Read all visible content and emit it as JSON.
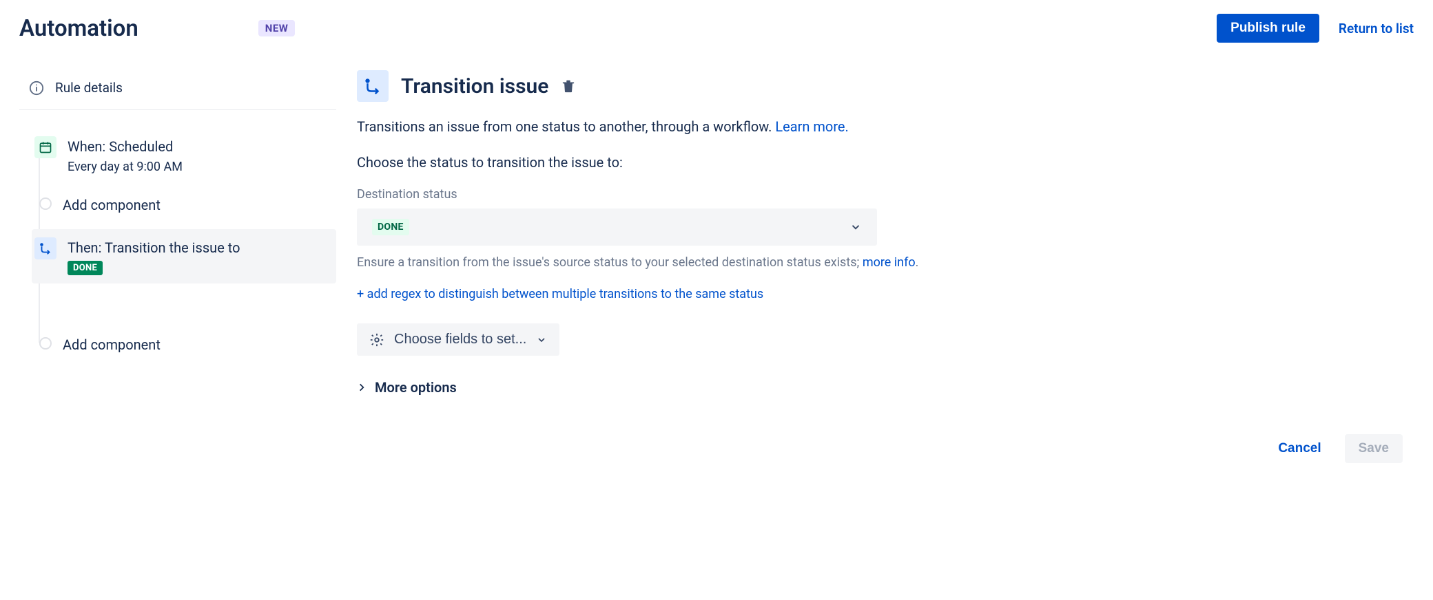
{
  "header": {
    "title": "Automation",
    "badge": "NEW",
    "publish_label": "Publish rule",
    "return_label": "Return to list"
  },
  "sidebar": {
    "rule_details_label": "Rule details",
    "nodes": [
      {
        "title": "When: Scheduled",
        "subtitle": "Every day at 9:00 AM"
      },
      {
        "title": "Add component"
      },
      {
        "title": "Then: Transition the issue to",
        "status": "DONE"
      },
      {
        "title": "Add component"
      }
    ]
  },
  "panel": {
    "title": "Transition issue",
    "description_prefix": "Transitions an issue from one status to another, through a workflow. ",
    "learn_more": "Learn more.",
    "choose_label": "Choose the status to transition the issue to:",
    "dest_label": "Destination status",
    "dest_value": "DONE",
    "helper_prefix": "Ensure a transition from the issue's source status to your selected destination status exists; ",
    "helper_link": "more info",
    "add_regex": "+ add regex to distinguish between multiple transitions to the same status",
    "fields_button": "Choose fields to set...",
    "more_options": "More options"
  },
  "footer": {
    "cancel": "Cancel",
    "save": "Save"
  }
}
